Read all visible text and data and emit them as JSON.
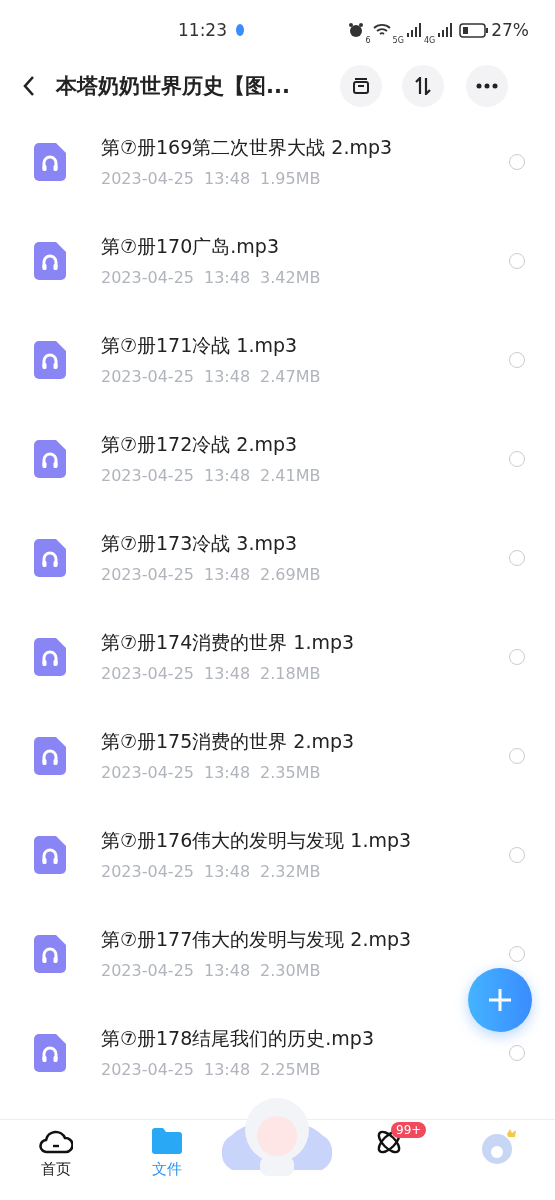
{
  "status_bar": {
    "time": "11:23",
    "wifi_tag": "6",
    "signal_tags": [
      "5G",
      "4G"
    ],
    "battery_text": "27%"
  },
  "header": {
    "title": "本塔奶奶世界历史【图..."
  },
  "files": [
    {
      "name": "第⑦册169第二次世界大战 2.mp3",
      "date": "2023-04-25",
      "time": "13:48",
      "size": "1.95MB",
      "selected": false
    },
    {
      "name": "第⑦册170广岛.mp3",
      "date": "2023-04-25",
      "time": "13:48",
      "size": "3.42MB",
      "selected": false
    },
    {
      "name": "第⑦册171冷战 1.mp3",
      "date": "2023-04-25",
      "time": "13:48",
      "size": "2.47MB",
      "selected": false
    },
    {
      "name": "第⑦册172冷战 2.mp3",
      "date": "2023-04-25",
      "time": "13:48",
      "size": "2.41MB",
      "selected": false
    },
    {
      "name": "第⑦册173冷战 3.mp3",
      "date": "2023-04-25",
      "time": "13:48",
      "size": "2.69MB",
      "selected": false
    },
    {
      "name": "第⑦册174消费的世界 1.mp3",
      "date": "2023-04-25",
      "time": "13:48",
      "size": "2.18MB",
      "selected": false
    },
    {
      "name": "第⑦册175消费的世界 2.mp3",
      "date": "2023-04-25",
      "time": "13:48",
      "size": "2.35MB",
      "selected": false
    },
    {
      "name": "第⑦册176伟大的发明与发现 1.mp3",
      "date": "2023-04-25",
      "time": "13:48",
      "size": "2.32MB",
      "selected": false
    },
    {
      "name": "第⑦册177伟大的发明与发现 2.mp3",
      "date": "2023-04-25",
      "time": "13:48",
      "size": "2.30MB",
      "selected": false
    },
    {
      "name": "第⑦册178结尾我们的历史.mp3",
      "date": "2023-04-25",
      "time": "13:48",
      "size": "2.25MB",
      "selected": false
    }
  ],
  "bottom_nav": [
    {
      "kind": "home",
      "label": "首页",
      "selected": false
    },
    {
      "kind": "files",
      "label": "文件",
      "selected": true
    },
    {
      "kind": "mascot"
    },
    {
      "kind": "discover",
      "badge": "99+",
      "selected": false
    },
    {
      "kind": "profile",
      "selected": false
    }
  ]
}
